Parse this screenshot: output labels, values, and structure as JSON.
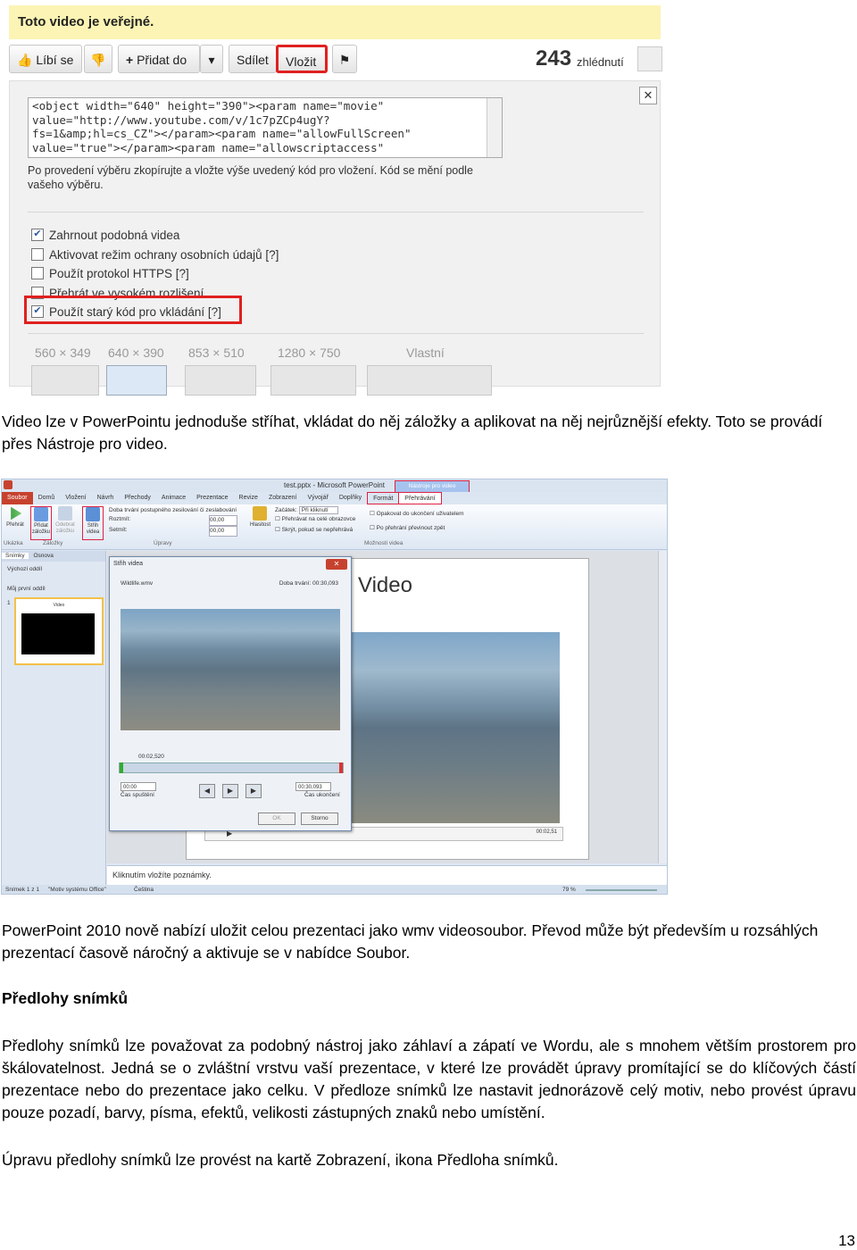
{
  "youtube": {
    "banner": "Toto video je veřejné.",
    "buttons": {
      "like": "Líbí se",
      "add_to": "Přidat do",
      "share": "Sdílet",
      "embed": "Vložit"
    },
    "views_count": "243",
    "views_label": "zhlédnutí",
    "embed_code": "<object width=\"640\" height=\"390\"><param name=\"movie\"\nvalue=\"http://www.youtube.com/v/1c7pZCp4ugY?\nfs=1&amp;hl=cs_CZ\"></param><param name=\"allowFullScreen\"\nvalue=\"true\"></param><param name=\"allowscriptaccess\"",
    "embed_hint": "Po provedení výběru zkopírujte a vložte výše uvedený kód pro vložení. Kód se mění podle vašeho výběru.",
    "options": [
      {
        "label": "Zahrnout podobná videa",
        "checked": true
      },
      {
        "label": "Aktivovat režim ochrany osobních údajů [?]",
        "checked": false
      },
      {
        "label": "Použít protokol HTTPS [?]",
        "checked": false
      },
      {
        "label": "Přehrát ve vysokém rozlišení",
        "checked": false
      },
      {
        "label": "Použít starý kód pro vkládání [?]",
        "checked": true
      }
    ],
    "sizes": [
      "560 × 349",
      "640 × 390",
      "853 × 510",
      "1280 × 750",
      "Vlastní"
    ],
    "accent_color": "#e02020",
    "banner_color": "#fbf4b4"
  },
  "paragraph1": "Video lze v PowerPointu jednoduše stříhat, vkládat do něj záložky a aplikovat na něj nejrůznější efekty. Toto se provádí přes Nástroje pro video.",
  "powerpoint": {
    "title": "test.pptx - Microsoft PowerPoint",
    "context_tab": "Nástroje pro video",
    "tabs": [
      "Soubor",
      "Domů",
      "Vložení",
      "Návrh",
      "Přechody",
      "Animace",
      "Prezentace",
      "Revize",
      "Zobrazení",
      "Vývojář",
      "Doplňky",
      "Formát",
      "Přehrávání"
    ],
    "ribbon": {
      "play": "Přehrát",
      "add_bookmark": "Přidat záložku",
      "remove_bookmark": "Odebrat záložku",
      "trim": "Střih videa",
      "fade_label": "Doba trvání postupného zesilování či zeslabování",
      "fade_in": "Roztmít:",
      "fade_out": "Setmít:",
      "fade_in_value": "00,00",
      "fade_out_value": "00,00",
      "volume": "Hlasitost",
      "start": "Začátek:",
      "start_value": "Při kliknutí",
      "fullscreen": "Přehrávat na celé obrazovce",
      "hide": "Skrýt, pokud se nepřehrává",
      "loop": "Opakovat do ukončení uživatelem",
      "rewind": "Po přehrání převinout zpět",
      "group_preview": "Ukázka",
      "group_bookmarks": "Záložky",
      "group_edit": "Úpravy",
      "group_options": "Možnosti videa"
    },
    "left_panel": {
      "tab_slides": "Snímky",
      "tab_outline": "Osnova",
      "section_default": "Výchozí oddíl",
      "section_mine": "Můj první oddíl",
      "thumb_title": "Video",
      "slide_number": "1"
    },
    "slide_title": "Video",
    "player_time": "00:02,51",
    "dialog": {
      "title": "Střih videa",
      "file": "Wildlife.wmv",
      "duration": "Doba trvání: 00:30,093",
      "current_time": "00:02,520",
      "start_time": "00:00",
      "start_label": "Čas spuštění",
      "end_time": "00:30,093",
      "end_label": "Čas ukončení",
      "ok": "OK",
      "cancel": "Storno"
    },
    "notes": "Kliknutím vložíte poznámky.",
    "status": {
      "slide": "Snímek 1 z 1",
      "theme": "\"Motiv systému Office\"",
      "language": "Čeština",
      "zoom": "79 %"
    }
  },
  "paragraph2": "PowerPoint 2010 nově nabízí uložit celou prezentaci jako wmv videosoubor. Převod může být především u rozsáhlých prezentací časově náročný a aktivuje se v nabídce Soubor.",
  "heading": "Předlohy snímků",
  "paragraph3": "Předlohy snímků lze považovat za podobný nástroj jako záhlaví a zápatí ve Wordu, ale s mnohem větším prostorem pro škálovatelnost. Jedná se o zvláštní vrstvu vaší prezentace, v které lze provádět úpravy promítající se do klíčových částí prezentace nebo do prezentace jako celku. V předloze snímků lze nastavit jednorázově celý motiv, nebo provést úpravu pouze pozadí, barvy, písma, efektů, velikosti zástupných znaků nebo umístění.",
  "paragraph4": "Úpravu předlohy snímků lze provést na kartě Zobrazení, ikona Předloha snímků.",
  "page_number": "13"
}
